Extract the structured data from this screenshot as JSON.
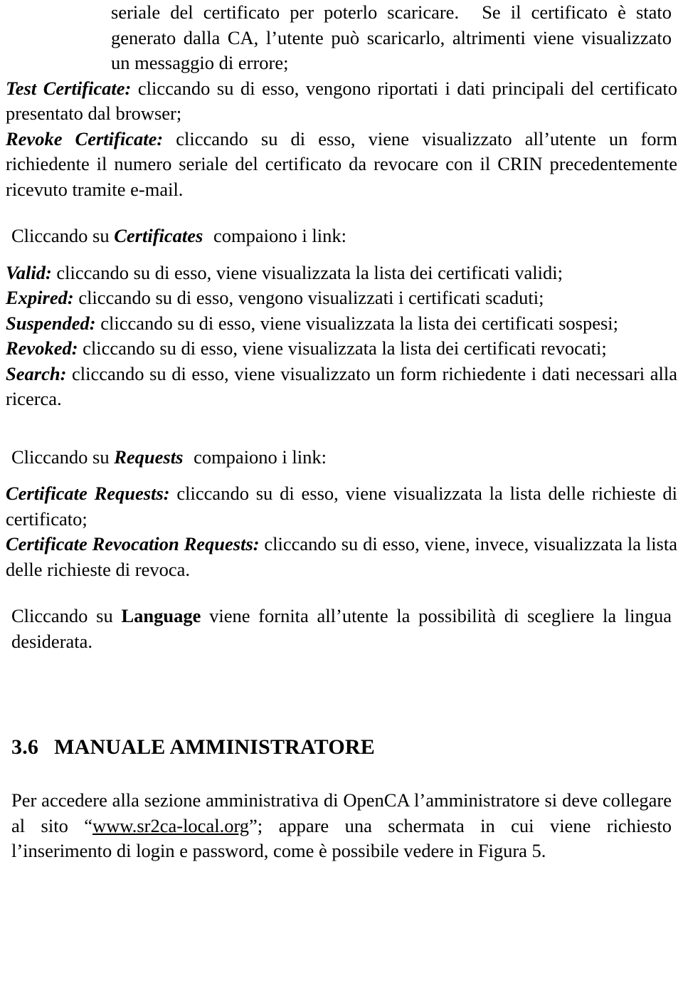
{
  "document": {
    "top_paragraph": {
      "line1": "seriale del certificato per poterlo scaricare.",
      "rest": "Se il certificato è stato generato dalla CA, l’utente può scaricarlo, altrimenti viene visualizzato un messaggio di errore;"
    },
    "top_bullets": [
      {
        "term": "Test Certificate:",
        "text": "cliccando su di esso, vengono riportati i dati principali del certificato presentato dal browser;"
      },
      {
        "term": "Revoke Certificate:",
        "text": "cliccando su di esso, viene visualizzato all’utente un form richiedente il numero seriale del certificato da revocare con il CRIN precedentemente ricevuto tramite e-mail."
      }
    ],
    "lead_certificates": {
      "prefix": "Cliccando su",
      "term": "Certificates",
      "suffix": "compaiono i link:"
    },
    "certificates_bullets": [
      {
        "term": "Valid:",
        "text": "cliccando su di esso, viene visualizzata la lista dei certificati validi;"
      },
      {
        "term": "Expired:",
        "text": "cliccando su di esso, vengono visualizzati i certificati scaduti;"
      },
      {
        "term": "Suspended:",
        "text": "cliccando su di esso, viene visualizzata la lista dei certificati sospesi;"
      },
      {
        "term": "Revoked:",
        "text": "cliccando su di esso, viene visualizzata la lista dei certificati revocati;"
      },
      {
        "term": "Search:",
        "text": "cliccando su di esso, viene visualizzato un form richiedente i dati necessari alla ricerca."
      }
    ],
    "lead_requests": {
      "prefix": "Cliccando su",
      "term": "Requests",
      "suffix": "compaiono i  link:"
    },
    "requests_bullets": [
      {
        "term": "Certificate Requests:",
        "text": "cliccando su di esso, viene visualizzata la lista delle richieste di certificato;"
      },
      {
        "term": "Certificate Revocation Requests:",
        "text": "cliccando su di esso, viene, invece, visualizzata la lista delle richieste di  revoca."
      }
    ],
    "lead_language": {
      "prefix": "Cliccando su",
      "term": "Language",
      "suffix": "viene fornita all’utente la possibilità di scegliere la lingua desiderata."
    },
    "section": {
      "number": "3.6",
      "title": "MANUALE AMMINISTRATORE"
    },
    "final_paragraph": {
      "part1": "Per accedere alla sezione amministrativa di OpenCA l’amministratore si deve collegare al sito “",
      "link": "www.sr2ca-local.org",
      "part2": "”; appare una schermata in cui viene richiesto l’inserimento di login e password, come è possibile vedere in Figura 5."
    }
  }
}
